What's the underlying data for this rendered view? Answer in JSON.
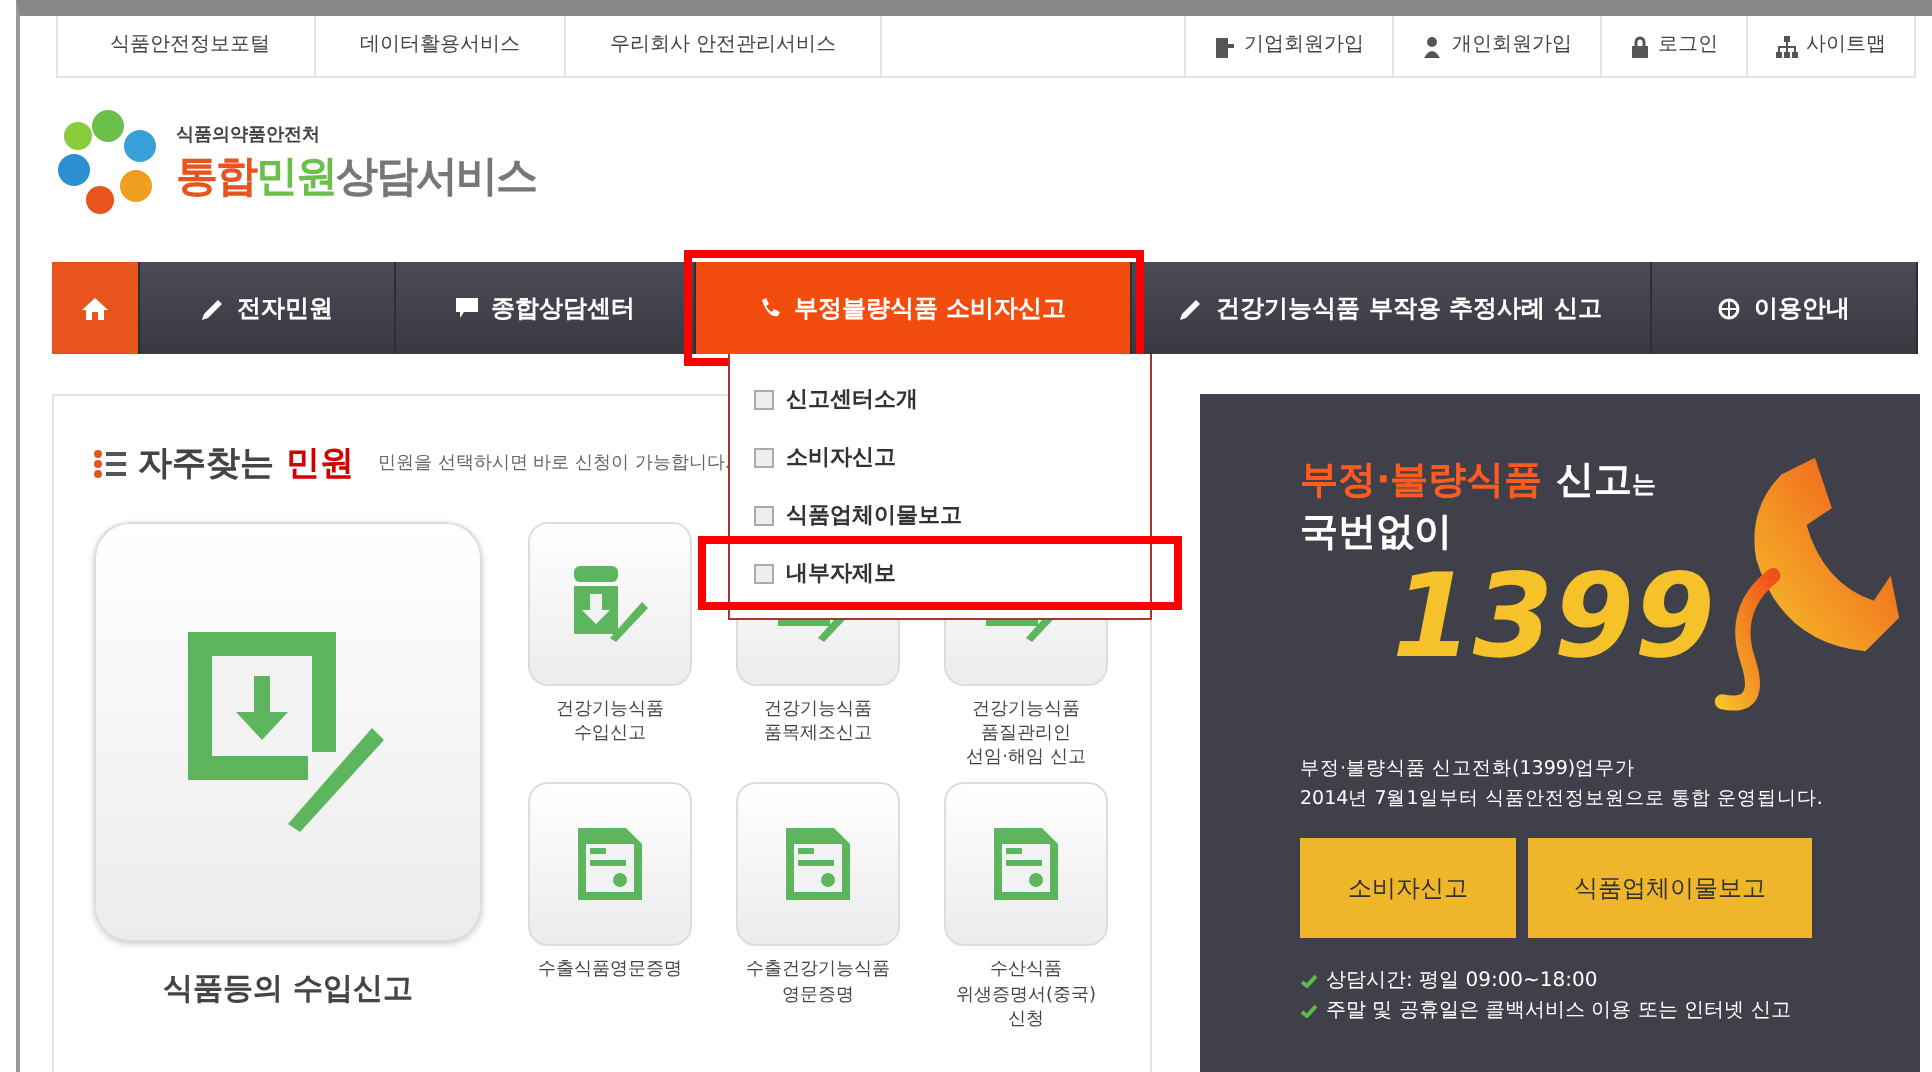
{
  "top_links": [
    "식품안전정보포털",
    "데이터활용서비스",
    "우리회사 안전관리서비스"
  ],
  "account_links": [
    {
      "label": "기업회원가입",
      "kind": "company"
    },
    {
      "label": "개인회원가입",
      "kind": "person"
    },
    {
      "label": "로그인",
      "kind": "lock"
    },
    {
      "label": "사이트맵",
      "kind": "sitemap"
    }
  ],
  "logo": {
    "agency": "식품의약품안전처",
    "title_parts": [
      "통합",
      "민원",
      "상담서비스"
    ]
  },
  "nav": [
    {
      "kind": "home",
      "selected": false,
      "highlighted": false
    },
    {
      "kind": "pen",
      "label": "전자민원",
      "selected": false,
      "highlighted": false
    },
    {
      "kind": "chat",
      "label": "종합상담센터",
      "selected": false,
      "highlighted": false
    },
    {
      "kind": "phone",
      "label": "부정불량식품 소비자신고",
      "selected": true,
      "highlighted": true
    },
    {
      "kind": "pen",
      "label": "건강기능식품 부작용 추정사례 신고",
      "selected": false,
      "highlighted": false
    },
    {
      "kind": "globe",
      "label": "이용안내",
      "selected": false,
      "highlighted": false
    }
  ],
  "dropdown": [
    {
      "label": "신고센터소개",
      "highlighted": false
    },
    {
      "label": "소비자신고",
      "highlighted": false
    },
    {
      "label": "식품업체이물보고",
      "highlighted": false
    },
    {
      "label": "내부자제보",
      "highlighted": true
    }
  ],
  "popular": {
    "title": "자주찾는",
    "title_accent": "민원",
    "hint": "민원을 선택하시면 바로 신청이 가능합니다.",
    "featured": "식품등의 수입신고",
    "tiles": [
      {
        "kind": "jar",
        "lines": [
          "건강기능식품",
          "수입신고"
        ]
      },
      {
        "kind": "doc",
        "lines": [
          "건강기능식품",
          "품목제조신고"
        ]
      },
      {
        "kind": "cycle",
        "lines": [
          "건강기능식품",
          "품질관리인",
          "선임·해임 신고"
        ]
      },
      {
        "kind": "form",
        "lines": [
          "수출식품영문증명"
        ]
      },
      {
        "kind": "form",
        "lines": [
          "수출건강기능식품",
          "영문증명"
        ]
      },
      {
        "kind": "form",
        "lines": [
          "수산식품",
          "위생증명서(중국)",
          "신청"
        ]
      }
    ]
  },
  "hotline": {
    "headline_accent": "부정·불량식품",
    "headline": "신고",
    "headline_particle": "는",
    "line2": "국번없이",
    "number": "1399",
    "description": [
      "부정·불량식품 신고전화(1399)업무가",
      "2014년 7월1일부터 식품안전정보원으로 통합 운영됩니다."
    ],
    "buttons": [
      "소비자신고",
      "식품업체이물보고"
    ],
    "notes": [
      "상담시간: 평일 09:00~18:00",
      "주말 및 공휴일은 콜백서비스 이용 또는 인터넷 신고"
    ]
  }
}
